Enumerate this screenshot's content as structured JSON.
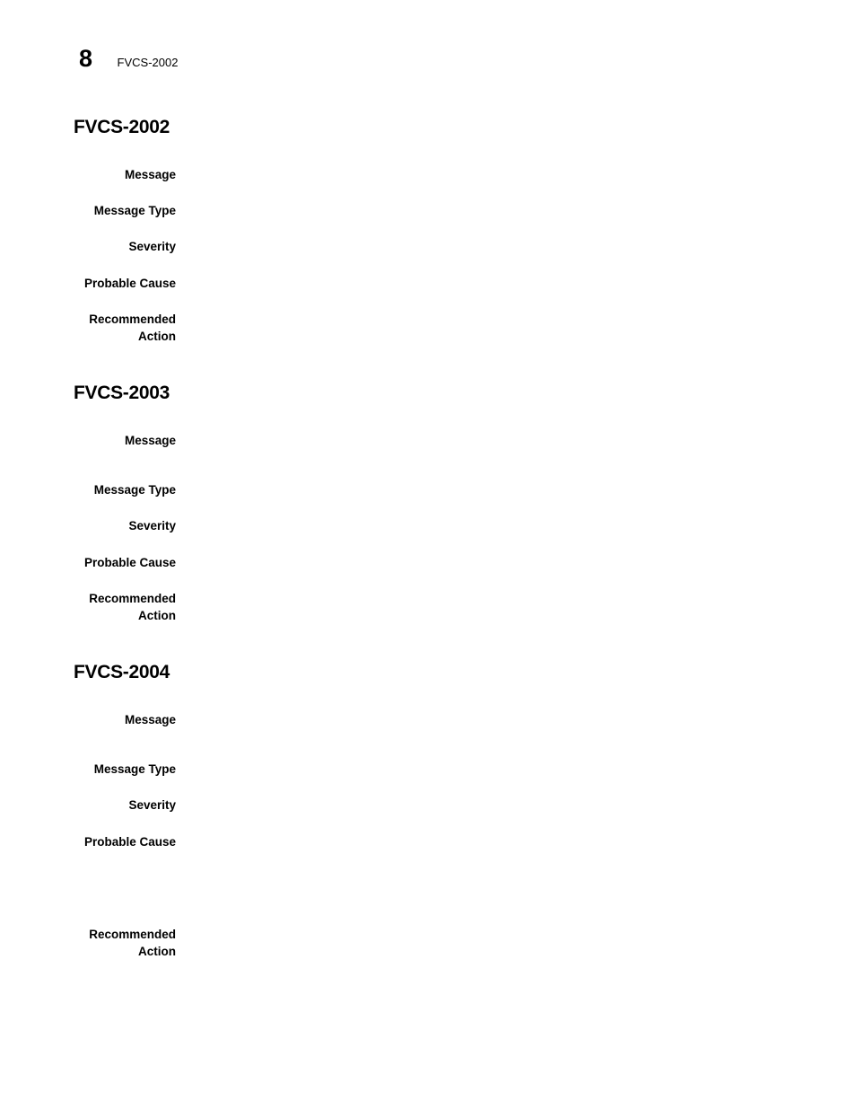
{
  "header": {
    "page_number": "8",
    "running_title": "FVCS-2002"
  },
  "sections": [
    {
      "heading": "FVCS-2002",
      "fields": [
        {
          "label": "Message",
          "value": ""
        },
        {
          "label": "Message Type",
          "value": ""
        },
        {
          "label": "Severity",
          "value": ""
        },
        {
          "label": "Probable Cause",
          "value": ""
        },
        {
          "label": "Recommended Action",
          "value": ""
        }
      ]
    },
    {
      "heading": "FVCS-2003",
      "fields": [
        {
          "label": "Message",
          "value": ""
        },
        {
          "label": "Message Type",
          "value": ""
        },
        {
          "label": "Severity",
          "value": ""
        },
        {
          "label": "Probable Cause",
          "value": ""
        },
        {
          "label": "Recommended Action",
          "value": ""
        }
      ]
    },
    {
      "heading": "FVCS-2004",
      "fields": [
        {
          "label": "Message",
          "value": ""
        },
        {
          "label": "Message Type",
          "value": ""
        },
        {
          "label": "Severity",
          "value": ""
        },
        {
          "label": "Probable Cause",
          "value": ""
        },
        {
          "label": "Recommended Action",
          "value": ""
        }
      ]
    }
  ]
}
